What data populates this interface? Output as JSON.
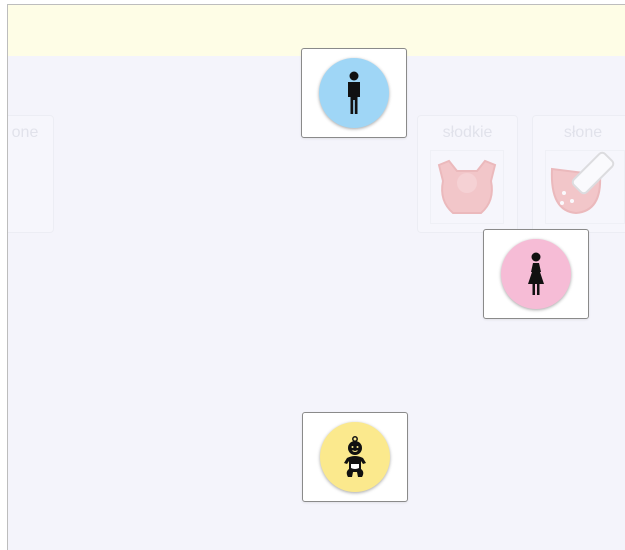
{
  "colors": {
    "page_background": "#f4f4fb",
    "top_band": "#fefde6",
    "man_circle": "#9fd6f6",
    "woman_circle": "#f6bcd6",
    "baby_circle": "#fbe98d"
  },
  "background_cards": [
    {
      "label": "one",
      "icon": "lemon-slice-icon"
    },
    {
      "label": "słodkie",
      "icon": "candy-icon"
    },
    {
      "label": "słone",
      "icon": "salt-shaker-icon"
    }
  ],
  "tiles": [
    {
      "name": "man-tile",
      "icon": "man-icon"
    },
    {
      "name": "woman-tile",
      "icon": "woman-icon"
    },
    {
      "name": "baby-tile",
      "icon": "baby-icon"
    }
  ]
}
